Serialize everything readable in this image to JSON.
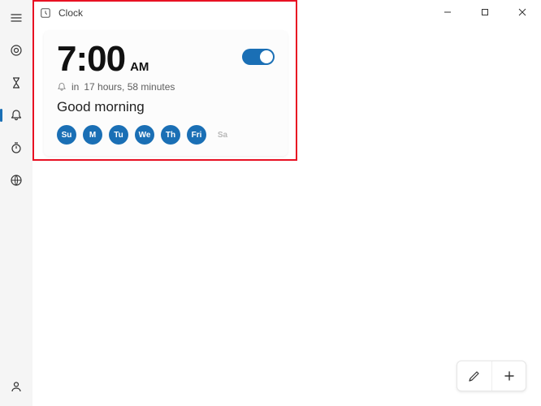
{
  "app": {
    "title": "Clock"
  },
  "sidebar": {
    "items": [
      {
        "id": "menu",
        "icon": "menu"
      },
      {
        "id": "focus",
        "icon": "focus"
      },
      {
        "id": "timer",
        "icon": "hourglass"
      },
      {
        "id": "alarm",
        "icon": "bell",
        "selected": true
      },
      {
        "id": "stopwatch",
        "icon": "stopwatch"
      },
      {
        "id": "worldclock",
        "icon": "globe"
      }
    ],
    "bottom": {
      "id": "account",
      "icon": "person"
    }
  },
  "alarm": {
    "time": "7:00",
    "ampm": "AM",
    "enabled": true,
    "remaining_prefix": "in",
    "remaining": "17 hours, 58 minutes",
    "name": "Good morning",
    "days": [
      {
        "label": "Su",
        "active": true
      },
      {
        "label": "M",
        "active": true
      },
      {
        "label": "Tu",
        "active": true
      },
      {
        "label": "We",
        "active": true
      },
      {
        "label": "Th",
        "active": true
      },
      {
        "label": "Fri",
        "active": true
      },
      {
        "label": "Sa",
        "active": false
      }
    ]
  },
  "colors": {
    "accent": "#1a6fb5",
    "highlight": "#e81123"
  }
}
